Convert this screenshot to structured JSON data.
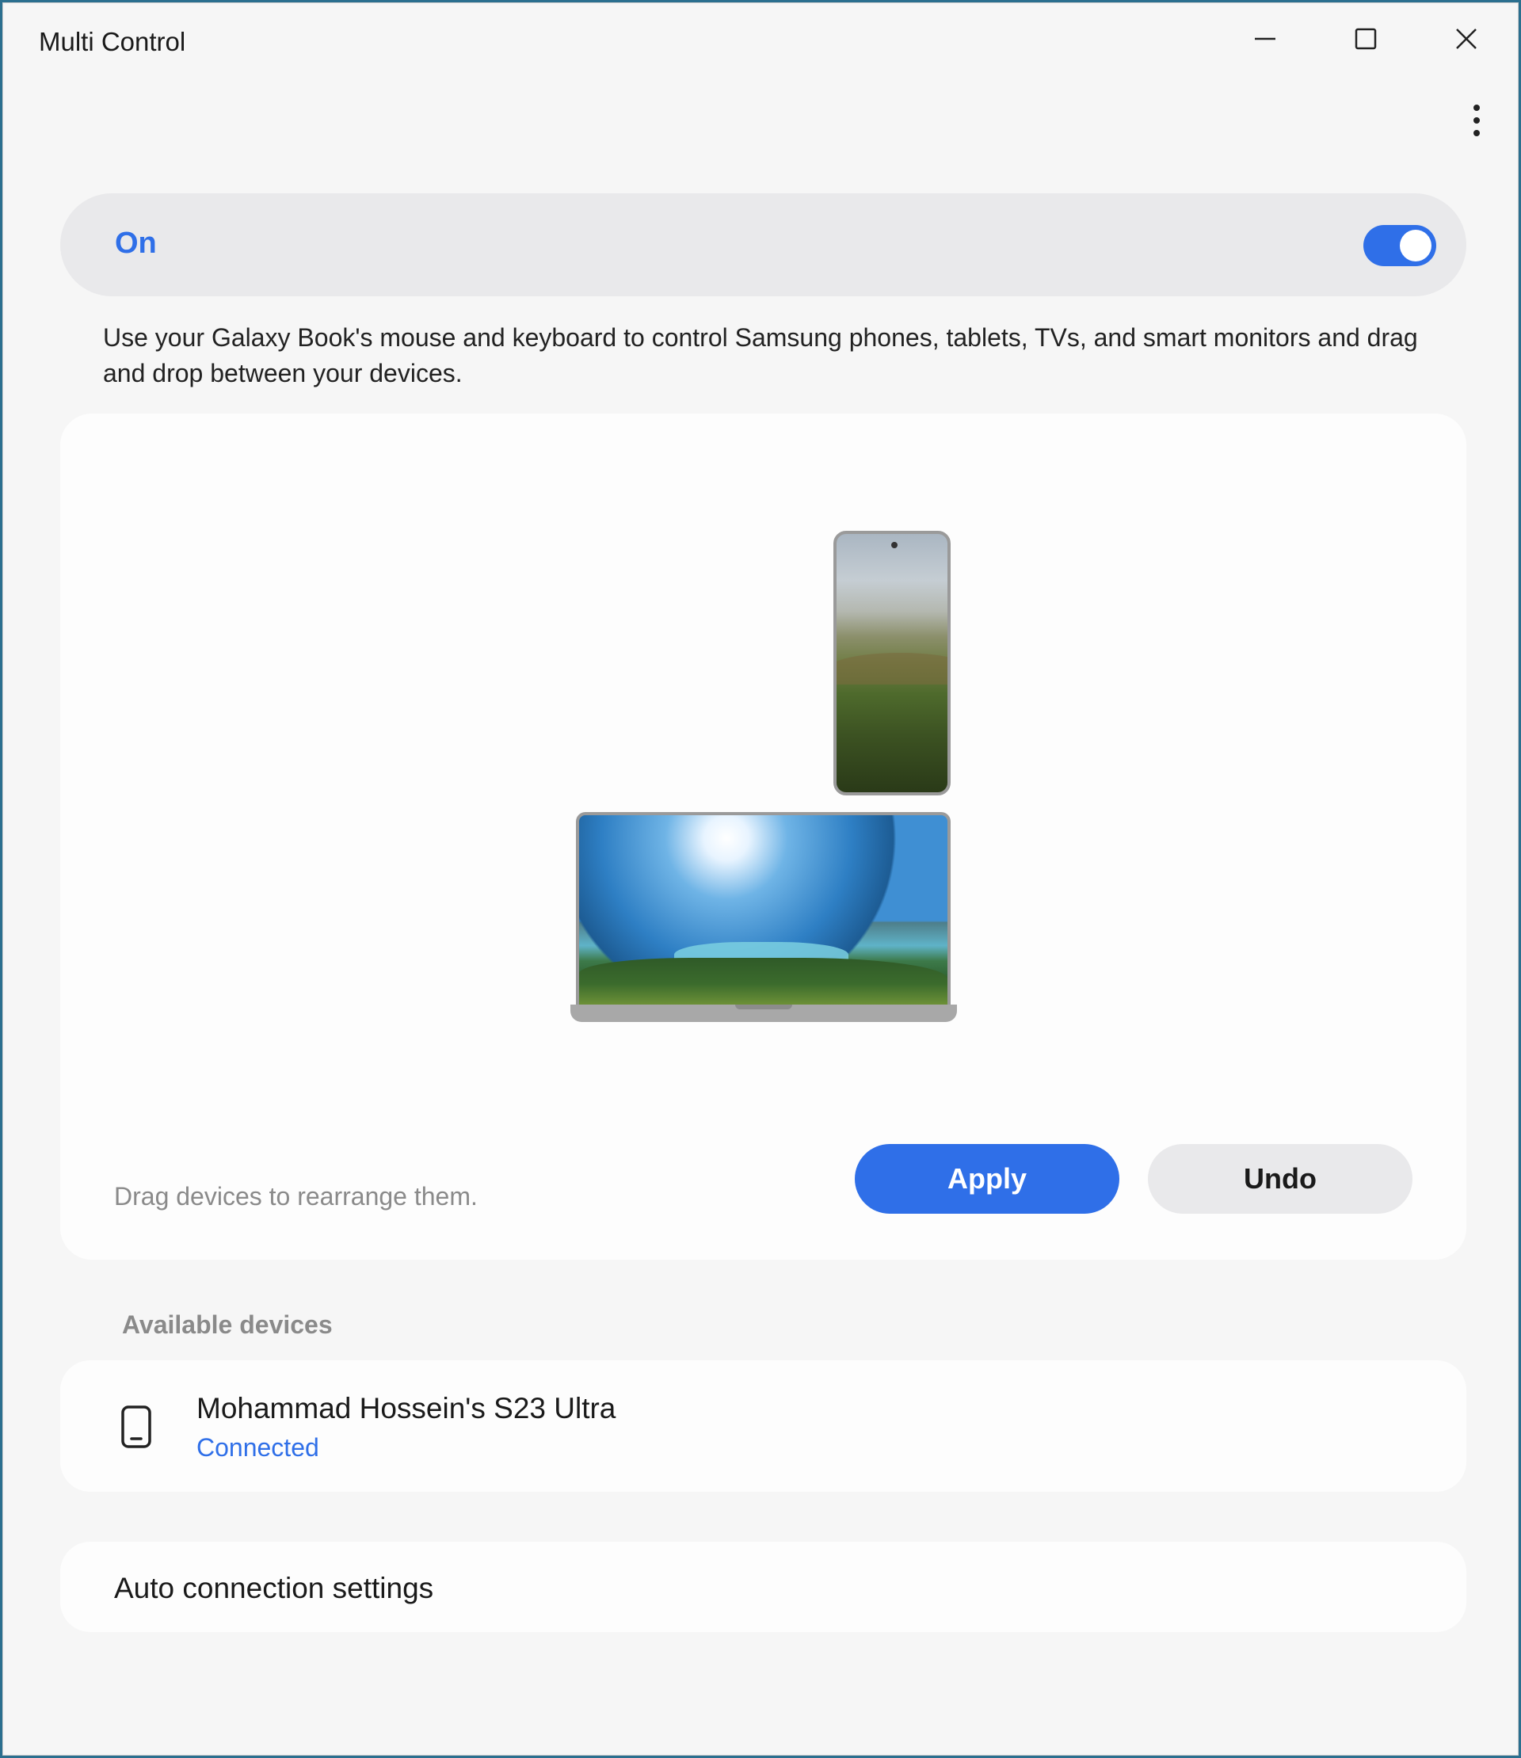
{
  "window": {
    "title": "Multi Control"
  },
  "toggle": {
    "label": "On",
    "state": "on",
    "accent_color": "#2f6fe8"
  },
  "description": "Use your Galaxy Book's mouse and keyboard to control Samsung phones, tablets, TVs, and smart monitors and drag and drop between your devices.",
  "arrangement": {
    "hint": "Drag devices to rearrange them.",
    "apply_label": "Apply",
    "undo_label": "Undo"
  },
  "available_devices": {
    "header": "Available devices",
    "devices": [
      {
        "name": "Mohammad Hossein's S23 Ultra",
        "status": "Connected",
        "icon": "phone-icon"
      }
    ]
  },
  "auto_connection": {
    "label": "Auto connection settings"
  },
  "icons": {
    "minimize": "minimize-icon",
    "maximize": "maximize-icon",
    "close": "close-icon",
    "more": "more-vertical-icon"
  }
}
